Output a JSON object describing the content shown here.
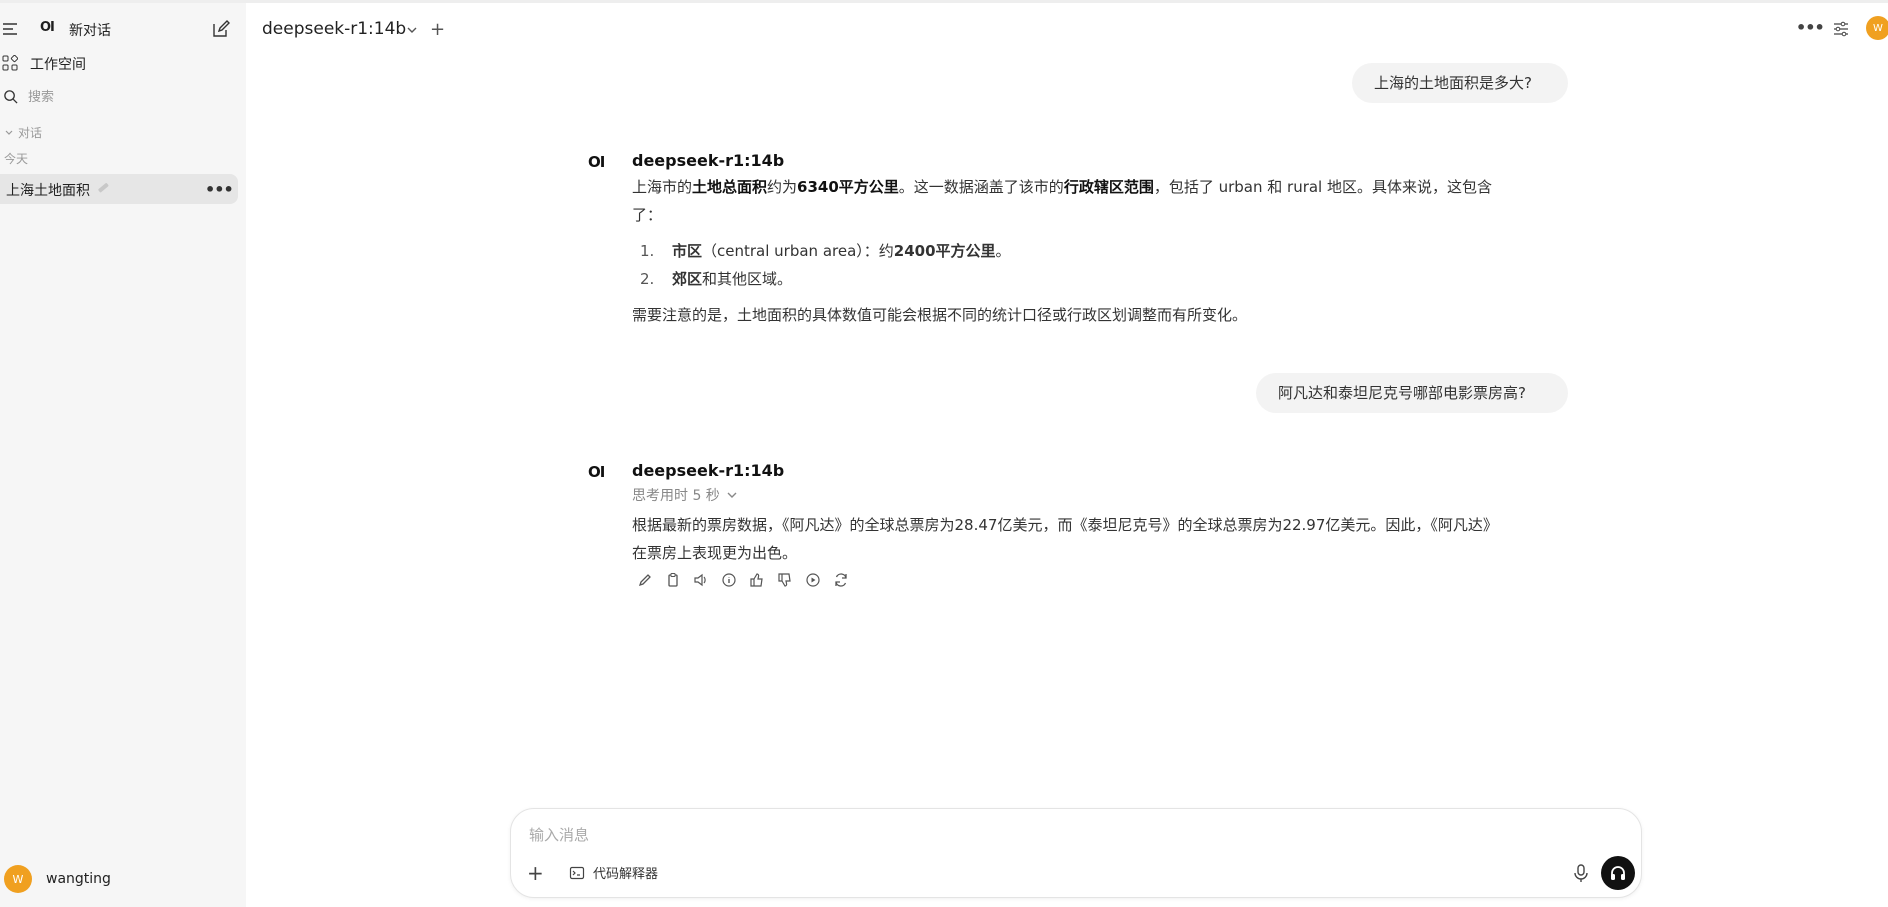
{
  "sidebar": {
    "logo": "OI",
    "new_chat": "新对话",
    "workspace": "工作空间",
    "search_placeholder": "搜索",
    "section_label": "对话",
    "today_label": "今天",
    "chat_item": "上海土地面积",
    "chat_more": "•••",
    "user_initial": "W",
    "username": "wangting"
  },
  "header": {
    "model": "deepseek-r1:14b",
    "add": "+",
    "more": "•••",
    "avatar_initial": "W"
  },
  "messages": {
    "user1": "上海的土地面积是多大?",
    "ai1": {
      "logo": "OI",
      "name": "deepseek-r1:14b",
      "p1_a": "上海市的",
      "p1_b": "土地总面积",
      "p1_c": "约为",
      "p1_d": "6340平方公里",
      "p1_e": "。这一数据涵盖了该市的",
      "p1_f": "行政辖区范围",
      "p1_g": "，包括了 urban 和 rural 地区。具体来说，这包含",
      "p1_h": "了：",
      "li1_num": "1.",
      "li1_a": "市区",
      "li1_b": "（central urban area）：约",
      "li1_c": "2400平方公里",
      "li1_d": "。",
      "li2_num": "2.",
      "li2_a": "郊区",
      "li2_b": "和其他区域。",
      "p2": "需要注意的是，土地面积的具体数值可能会根据不同的统计口径或行政区划调整而有所变化。"
    },
    "user2": "阿凡达和泰坦尼克号哪部电影票房高?",
    "ai2": {
      "logo": "OI",
      "name": "deepseek-r1:14b",
      "think": "思考用时 5 秒",
      "line1": "根据最新的票房数据，《阿凡达》的全球总票房为28.47亿美元，而《泰坦尼克号》的全球总票房为22.97亿美元。因此，《阿凡达》",
      "line2": "在票房上表现更为出色。"
    }
  },
  "composer": {
    "placeholder": "输入消息",
    "plus": "+",
    "tool_label": "代码解释器"
  },
  "colors": {
    "sidebar_bg": "#f6f6f6",
    "avatar": "#f0a020",
    "bubble": "#f3f3f3"
  }
}
